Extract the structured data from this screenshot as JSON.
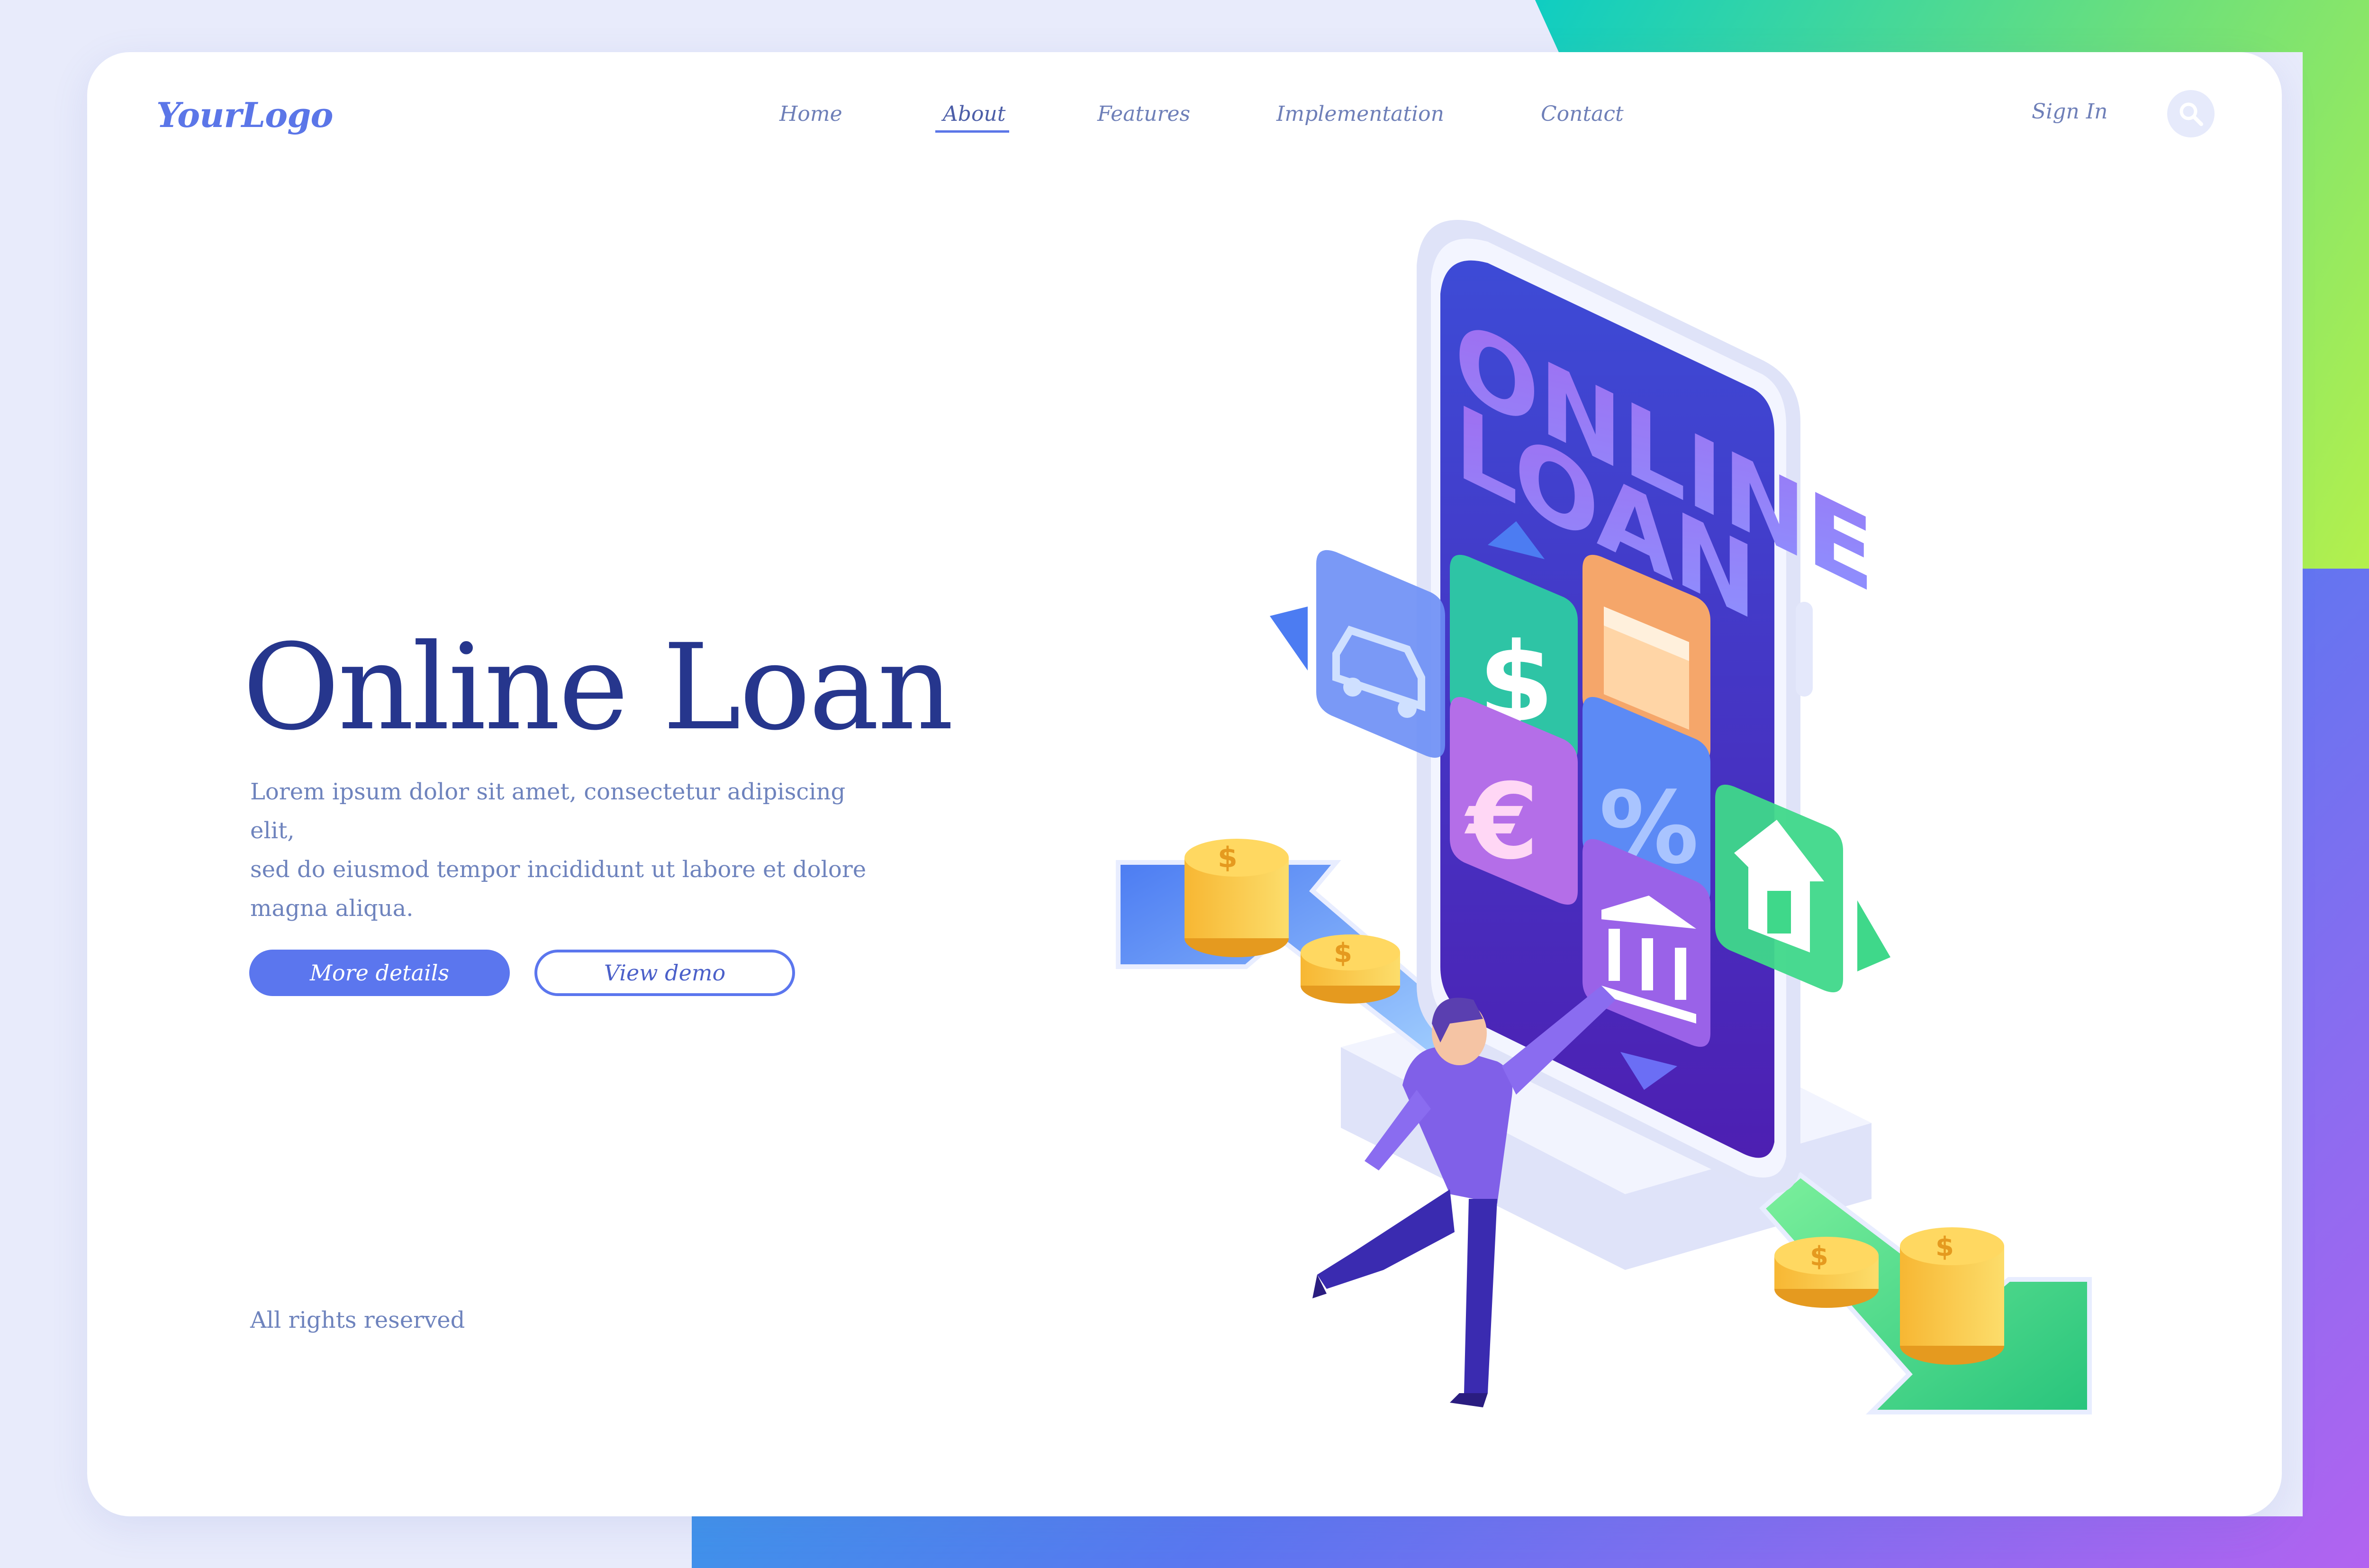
{
  "header": {
    "logo": "YourLogo",
    "nav": [
      {
        "label": "Home"
      },
      {
        "label": "About"
      },
      {
        "label": "Features"
      },
      {
        "label": "Implementation"
      },
      {
        "label": "Contact"
      }
    ],
    "active_nav": "About",
    "sign_in": "Sign In"
  },
  "hero": {
    "title": "Online Loan",
    "description_lines": [
      "Lorem ipsum dolor sit amet, consectetur adipiscing elit,",
      "sed do eiusmod tempor incididunt ut labore et dolore",
      "magna aliqua."
    ],
    "primary_button": "More details",
    "secondary_button": "View demo"
  },
  "footer": {
    "text": "All rights reserved"
  },
  "illustration": {
    "phone_text_line1": "ONLINE",
    "phone_text_line2": "LOAN",
    "app_icons": [
      "car-icon",
      "dollar-icon",
      "calendar-icon",
      "euro-icon",
      "percent-icon",
      "house-icon",
      "bank-icon"
    ],
    "coin_symbol": "$"
  },
  "colors": {
    "accent": "#5b76ee",
    "title": "#26368d",
    "text": "#6e83bd",
    "phone_screen": "#4a2fb8"
  }
}
